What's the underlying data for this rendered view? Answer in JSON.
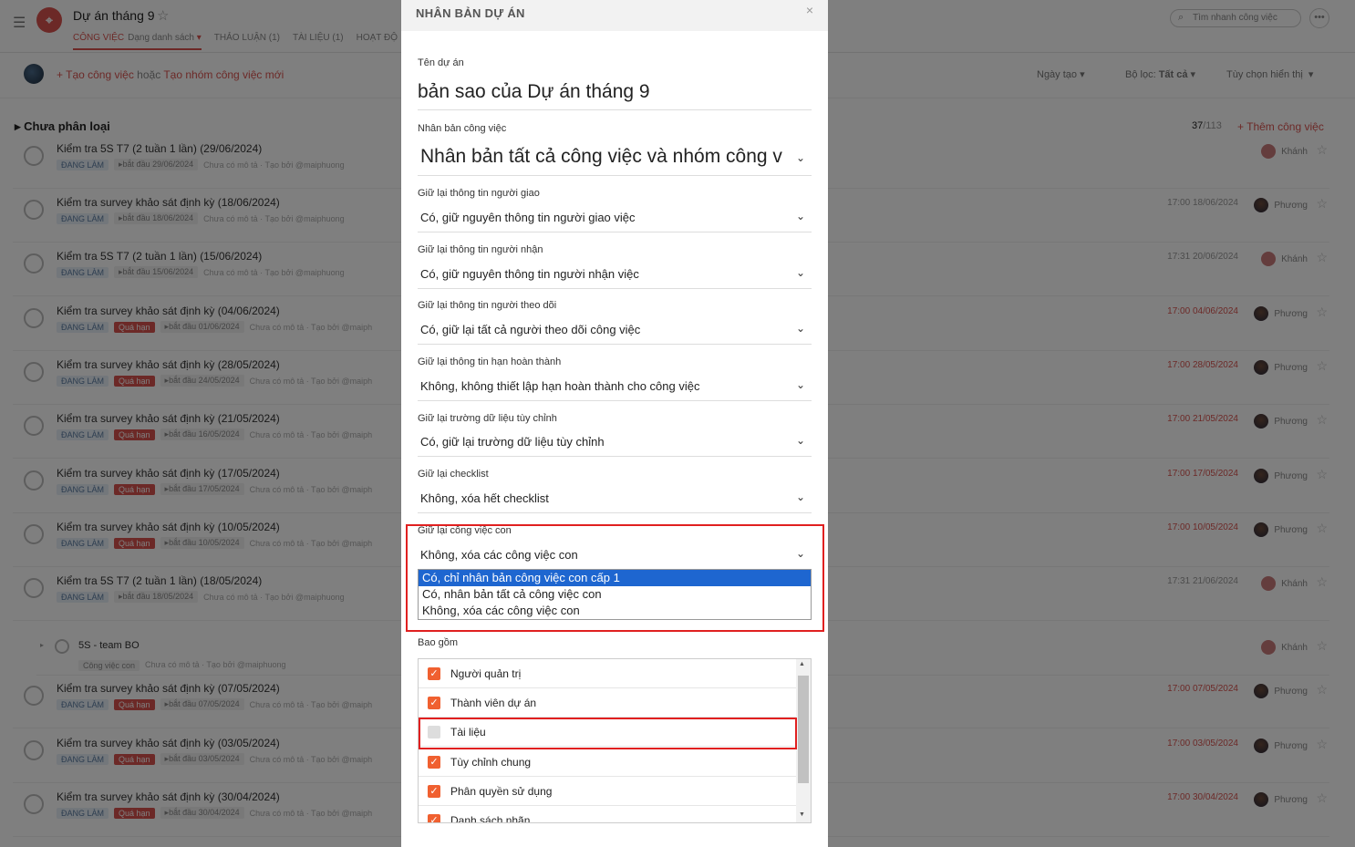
{
  "app": {
    "project_title": "Dự án tháng 9",
    "tabs": [
      {
        "label": "CÔNG VIỆC",
        "sub": "Dạng danh sách"
      },
      {
        "label": "THẢO LUẬN (1)"
      },
      {
        "label": "TÀI LIỆU (1)"
      },
      {
        "label": "HOẠT ĐỘ"
      }
    ],
    "search_placeholder": "Tìm nhanh công việc",
    "toolbar": {
      "create_task": "Tạo công việc",
      "or": " hoặc ",
      "create_group": "Tạo nhóm công việc mới",
      "sort": "Ngày tạo",
      "filter_label": "Bộ lọc:",
      "filter_value": "Tất cả",
      "display": "Tùy chọn hiển thị"
    },
    "group": {
      "name": "Chưa phân loại",
      "count": "37",
      "total": "/113",
      "add_task": "Thêm công việc"
    },
    "tasks": [
      {
        "title": "Kiểm tra 5S T7 (2 tuần 1 lần) (29/06/2024)",
        "status": "ĐANG LÀM",
        "overdue": "",
        "start": "bắt đầu 29/06/2024",
        "desc": "Chưa có mô tả · Tạo bởi @maiphuong",
        "date": "",
        "user": "Khánh"
      },
      {
        "title": "Kiểm tra survey khảo sát định kỳ (18/06/2024)",
        "status": "ĐANG LÀM",
        "overdue": "",
        "start": "bắt đầu 18/06/2024",
        "desc": "Chưa có mô tả · Tạo bởi @maiphuong",
        "date": "17:00 18/06/2024",
        "user": "Phương"
      },
      {
        "title": "Kiểm tra 5S T7 (2 tuần 1 lần) (15/06/2024)",
        "status": "ĐANG LÀM",
        "overdue": "",
        "start": "bắt đầu 15/06/2024",
        "desc": "Chưa có mô tả · Tạo bởi @maiphuong",
        "date": "17:31 20/06/2024",
        "user": "Khánh"
      },
      {
        "title": "Kiểm tra survey khảo sát định kỳ (04/06/2024)",
        "status": "ĐANG LÀM",
        "overdue": "Quá hạn",
        "start": "bắt đầu 01/06/2024",
        "desc": "Chưa có mô tả · Tạo bởi @maiph",
        "date": "17:00 04/06/2024",
        "user": "Phương"
      },
      {
        "title": "Kiểm tra survey khảo sát định kỳ (28/05/2024)",
        "status": "ĐANG LÀM",
        "overdue": "Quá hạn",
        "start": "bắt đầu 24/05/2024",
        "desc": "Chưa có mô tả · Tạo bởi @maiph",
        "date": "17:00 28/05/2024",
        "user": "Phương"
      },
      {
        "title": "Kiểm tra survey khảo sát định kỳ (21/05/2024)",
        "status": "ĐANG LÀM",
        "overdue": "Quá hạn",
        "start": "bắt đầu 16/05/2024",
        "desc": "Chưa có mô tả · Tạo bởi @maiph",
        "date": "17:00 21/05/2024",
        "user": "Phương"
      },
      {
        "title": "Kiểm tra survey khảo sát định kỳ (17/05/2024)",
        "status": "ĐANG LÀM",
        "overdue": "Quá hạn",
        "start": "bắt đầu 17/05/2024",
        "desc": "Chưa có mô tả · Tạo bởi @maiph",
        "date": "17:00 17/05/2024",
        "user": "Phương"
      },
      {
        "title": "Kiểm tra survey khảo sát định kỳ (10/05/2024)",
        "status": "ĐANG LÀM",
        "overdue": "Quá hạn",
        "start": "bắt đầu 10/05/2024",
        "desc": "Chưa có mô tả · Tạo bởi @maiph",
        "date": "17:00 10/05/2024",
        "user": "Phương"
      },
      {
        "title": "Kiểm tra 5S T7 (2 tuần 1 lần) (18/05/2024)",
        "status": "ĐANG LÀM",
        "overdue": "",
        "start": "bắt đầu 18/05/2024",
        "desc": "Chưa có mô tả · Tạo bởi @maiphuong",
        "date": "17:31 21/06/2024",
        "user": "Khánh"
      },
      {
        "title": "Kiểm tra survey khảo sát định kỳ (07/05/2024)",
        "status": "ĐANG LÀM",
        "overdue": "Quá hạn",
        "start": "bắt đầu 07/05/2024",
        "desc": "Chưa có mô tả · Tạo bởi @maiph",
        "date": "17:00 07/05/2024",
        "user": "Phương"
      },
      {
        "title": "Kiểm tra survey khảo sát định kỳ (03/05/2024)",
        "status": "ĐANG LÀM",
        "overdue": "Quá hạn",
        "start": "bắt đầu 03/05/2024",
        "desc": "Chưa có mô tả · Tạo bởi @maiph",
        "date": "17:00 03/05/2024",
        "user": "Phương"
      },
      {
        "title": "Kiểm tra survey khảo sát định kỳ (30/04/2024)",
        "status": "ĐANG LÀM",
        "overdue": "Quá hạn",
        "start": "bắt đầu 30/04/2024",
        "desc": "Chưa có mô tả · Tạo bởi @maiph",
        "date": "17:00 30/04/2024",
        "user": "Phương"
      }
    ],
    "subtask": {
      "title": "5S - team BO",
      "tag": "Công việc con",
      "desc": "Chưa có mô tả · Tạo bởi @maiphuong",
      "user": "Khánh"
    }
  },
  "modal": {
    "title": "NHÂN BẢN DỰ ÁN",
    "close": "×",
    "name_label": "Tên dự án",
    "name_value": "bản sao của Dự án tháng 9",
    "clone_tasks_label": "Nhân bản công việc",
    "clone_tasks_value": "Nhân bản tất cả công việc và nhóm công v",
    "assigner_label": "Giữ lại thông tin người giao",
    "assigner_value": "Có, giữ nguyên thông tin người giao việc",
    "assignee_label": "Giữ lại thông tin người nhận",
    "assignee_value": "Có, giữ nguyên thông tin người nhận việc",
    "follower_label": "Giữ lại thông tin người theo dõi",
    "follower_value": "Có, giữ lại tất cả người theo dõi công việc",
    "deadline_label": "Giữ lại thông tin hạn hoàn thành",
    "deadline_value": "Không, không thiết lập hạn hoàn thành cho công việc",
    "custom_field_label": "Giữ lại trường dữ liệu tùy chỉnh",
    "custom_field_value": "Có, giữ lại trường dữ liệu tùy chỉnh",
    "checklist_label": "Giữ lại checklist",
    "checklist_value": "Không, xóa hết checklist",
    "subtask_label": "Giữ lại công việc con",
    "subtask_value": "Không, xóa các công việc con",
    "subtask_options": [
      "Có, chỉ nhân bản công việc con cấp 1",
      "Có, nhân bản tất cả công việc con",
      "Không, xóa các công việc con"
    ],
    "include_label": "Bao gồm",
    "include_items": [
      {
        "label": "Người quản trị",
        "checked": true
      },
      {
        "label": "Thành viên dự án",
        "checked": true
      },
      {
        "label": "Tài liệu",
        "checked": false
      },
      {
        "label": "Tùy chỉnh chung",
        "checked": true
      },
      {
        "label": "Phân quyền sử dụng",
        "checked": true
      },
      {
        "label": "Danh sách nhãn",
        "checked": true
      }
    ]
  }
}
